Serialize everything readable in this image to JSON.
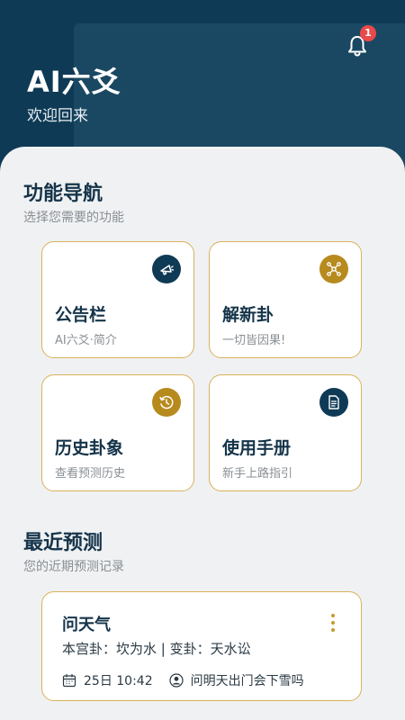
{
  "header": {
    "title": "AI六爻",
    "subtitle": "欢迎回来",
    "notification_count": "1",
    "bell_icon": "bell-icon"
  },
  "nav_section": {
    "title": "功能导航",
    "subtitle": "选择您需要的功能",
    "cards": [
      {
        "title": "公告栏",
        "subtitle": "AI六爻·简介",
        "icon": "megaphone-icon",
        "icon_color": "#0f3a55"
      },
      {
        "title": "解新卦",
        "subtitle": "一切皆因果!",
        "icon": "network-icon",
        "icon_color": "#b78a1e"
      },
      {
        "title": "历史卦象",
        "subtitle": "查看预测历史",
        "icon": "history-icon",
        "icon_color": "#b78a1e"
      },
      {
        "title": "使用手册",
        "subtitle": "新手上路指引",
        "icon": "document-icon",
        "icon_color": "#0f3a55"
      }
    ]
  },
  "recent_section": {
    "title": "最近预测",
    "subtitle": "您的近期预测记录",
    "records": [
      {
        "title": "问天气",
        "gua": "本宫卦：坎为水 | 变卦：天水讼",
        "time": "25日 10:42",
        "question": "问明天出门会下雪吗"
      }
    ]
  },
  "colors": {
    "header_bg": "#0f3a55",
    "accent_gold": "#d9b25a",
    "badge_red": "#e84a4a"
  }
}
